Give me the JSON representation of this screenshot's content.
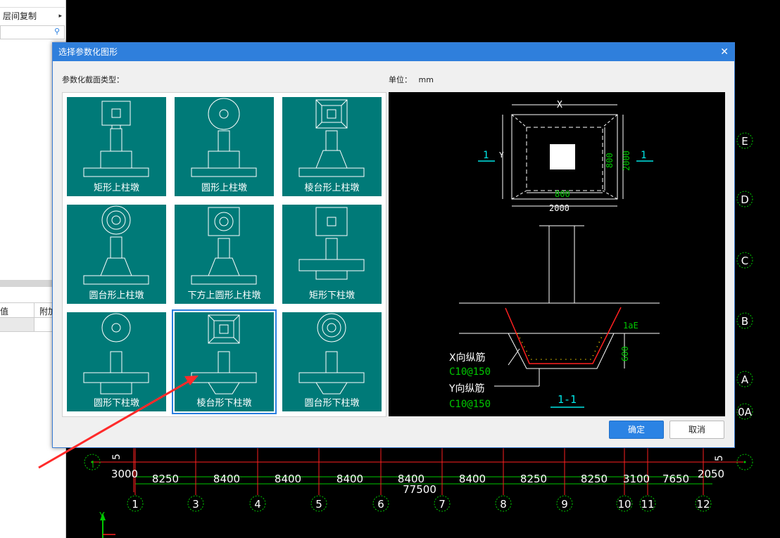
{
  "left_panel": {
    "copy_between_floors": "层间复制",
    "search_icon": "search-icon",
    "table_col_value": "值",
    "table_col_extra": "附加"
  },
  "dialog": {
    "title": "选择参数化图形",
    "section_type_label": "参数化截面类型：",
    "unit_label": "单位：",
    "unit_value": "mm",
    "tiles": [
      {
        "label": "矩形上柱墩"
      },
      {
        "label": "圆形上柱墩"
      },
      {
        "label": "棱台形上柱墩"
      },
      {
        "label": "圆台形上柱墩"
      },
      {
        "label": "下方上圆形上柱墩"
      },
      {
        "label": "矩形下柱墩"
      },
      {
        "label": "圆形下柱墩"
      },
      {
        "label": "棱台形下柱墩",
        "selected": true
      },
      {
        "label": "圆台形下柱墩"
      }
    ],
    "ok_label": "确定",
    "cancel_label": "取消"
  },
  "preview": {
    "dim_x": "X",
    "dim_y": "Y",
    "dim_800_h": "800",
    "dim_2000_h": "2000",
    "dim_800_v": "800",
    "dim_2000_v": "2000",
    "section_mark_left": "1",
    "section_mark_right": "1",
    "lae_label": "1aE",
    "dim_600": "600",
    "x_rebar_label": "X向纵筋",
    "x_rebar_spec": "C10@150",
    "y_rebar_label": "Y向纵筋",
    "y_rebar_spec": "C10@150",
    "section_title": "1-1"
  },
  "cad": {
    "axis_rows": [
      "E",
      "D",
      "C",
      "B",
      "A",
      "0A"
    ],
    "axis_cols": [
      "1",
      "3",
      "4",
      "5",
      "6",
      "7",
      "8",
      "9",
      "10",
      "11",
      "12"
    ],
    "dims_upper": [
      "3000",
      "2050"
    ],
    "dims_lower": [
      "8250",
      "8400",
      "8400",
      "8400",
      "8400",
      "8400",
      "8250",
      "8250",
      "3100",
      "7650"
    ],
    "total_dim": "77500",
    "y_axis_label": "Y",
    "side_text": "5",
    "right_text": "5"
  },
  "colors": {
    "title_bar": "#2f7fdc",
    "tile_bg": "#007a78",
    "cad_green": "#00c800",
    "cad_red": "#ff2020",
    "ok_button": "#2b83e4"
  }
}
